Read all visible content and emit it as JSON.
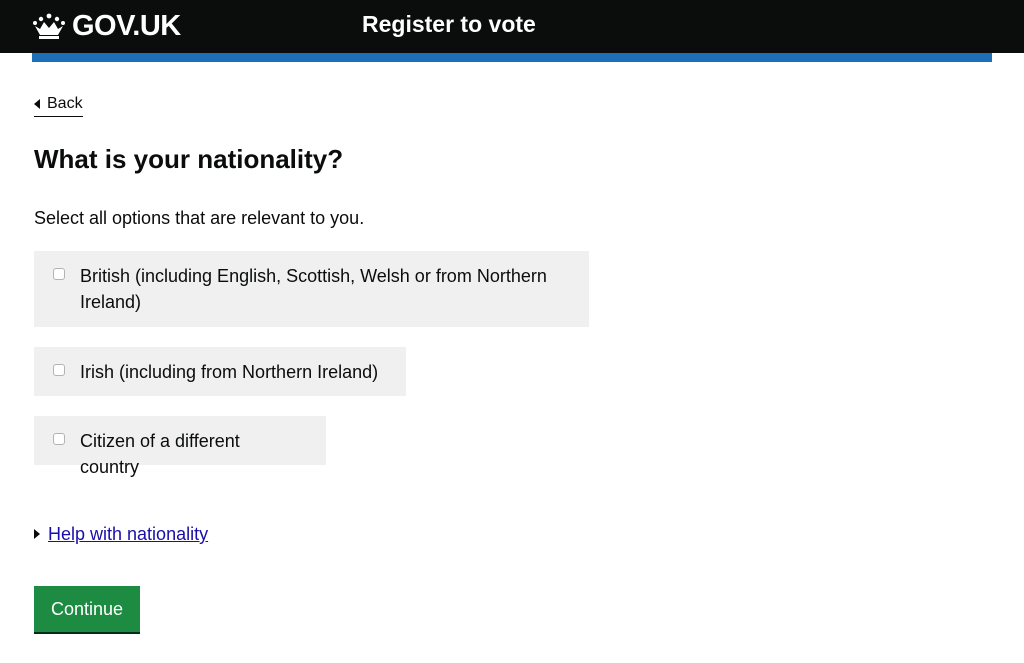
{
  "header": {
    "logo_text": "GOV.UK",
    "service_name": "Register to vote"
  },
  "back_link": {
    "label": "Back"
  },
  "question": {
    "heading": "What is your nationality?",
    "hint": "Select all options that are relevant to you."
  },
  "options": [
    {
      "label": "British (including English, Scottish, Welsh or from Northern Ireland)",
      "checked": false
    },
    {
      "label": "Irish (including from Northern Ireland)",
      "checked": false
    },
    {
      "label": "Citizen of a different country",
      "checked": false
    }
  ],
  "details": {
    "summary": "Help with nationality"
  },
  "continue_button": {
    "label": "Continue"
  },
  "colors": {
    "header_bg": "#0b0c0c",
    "accent_bar": "#1d70b8",
    "button_bg": "#1e8b43",
    "option_bg": "#f0f0f0",
    "link": "#1a0dab"
  },
  "icons": {
    "logo": "crown-icon",
    "back": "caret-left-icon",
    "details": "caret-right-icon"
  }
}
